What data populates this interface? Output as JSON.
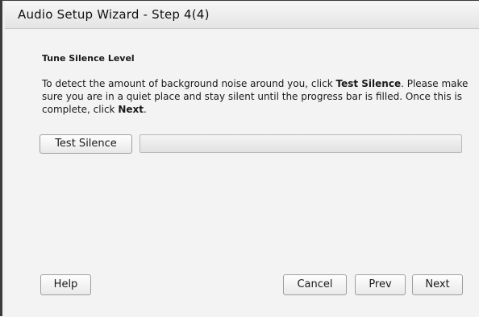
{
  "window": {
    "title": "Audio Setup Wizard - Step 4(4)"
  },
  "section": {
    "title": "Tune Silence Level"
  },
  "instructions": {
    "part1": "To detect the amount of background noise around you, click ",
    "bold1": "Test Silence",
    "part2": ". Please make sure you are in a quiet place and stay silent until the progress bar is filled. Once this is complete, click ",
    "bold2": "Next",
    "part3": "."
  },
  "test_button": {
    "label": "Test Silence"
  },
  "progress": {
    "value": 0
  },
  "footer": {
    "help_label": "Help",
    "cancel_label": "Cancel",
    "prev_label": "Prev",
    "next_label": "Next"
  }
}
